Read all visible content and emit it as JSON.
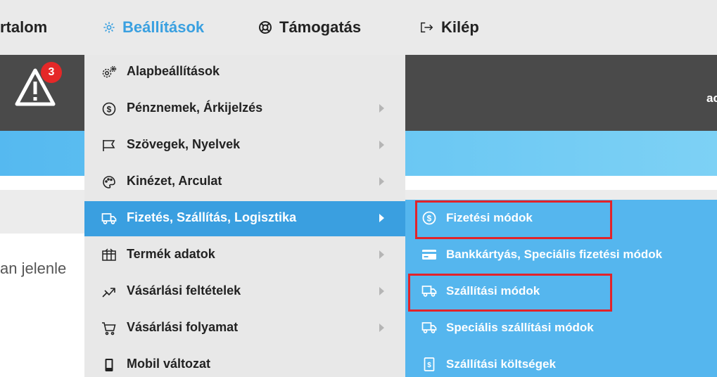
{
  "colors": {
    "accent": "#3aa0e0",
    "active_row": "#3a9fe0",
    "submenu_bg": "#55b6ee",
    "highlight": "#e2232a",
    "badge": "#e52828"
  },
  "topnav": {
    "items": [
      {
        "label": "rtalom",
        "icon": ""
      },
      {
        "label": "Beállítások",
        "icon": "gear-icon"
      },
      {
        "label": "Támogatás",
        "icon": "lifebuoy-icon"
      },
      {
        "label": "Kilép",
        "icon": "logout-icon"
      }
    ]
  },
  "background": {
    "alert_badge": "3",
    "header_right_text": "ac",
    "content_text": "an jelenle"
  },
  "menu": {
    "items": [
      {
        "label": "Alapbeállítások",
        "icon": "gears-icon",
        "has_submenu": false
      },
      {
        "label": "Pénznemek, Árkijelzés",
        "icon": "currency-icon",
        "has_submenu": true
      },
      {
        "label": "Szövegek, Nyelvek",
        "icon": "flag-icon",
        "has_submenu": true
      },
      {
        "label": "Kinézet, Arculat",
        "icon": "palette-icon",
        "has_submenu": true
      },
      {
        "label": "Fizetés, Szállítás, Logisztika",
        "icon": "truck-icon",
        "has_submenu": true,
        "active": true
      },
      {
        "label": "Termék adatok",
        "icon": "product-icon",
        "has_submenu": true
      },
      {
        "label": "Vásárlási feltételek",
        "icon": "handshake-icon",
        "has_submenu": true
      },
      {
        "label": "Vásárlási folyamat",
        "icon": "cart-icon",
        "has_submenu": true
      },
      {
        "label": "Mobil változat",
        "icon": "mobile-icon",
        "has_submenu": false
      }
    ]
  },
  "submenu": {
    "items": [
      {
        "label": "Fizetési módok",
        "icon": "currency-icon",
        "highlighted": true
      },
      {
        "label": "Bankkártyás, Speciális fizetési módok",
        "icon": "credit-card-icon",
        "highlighted": false
      },
      {
        "label": "Szállítási módok",
        "icon": "truck-icon",
        "highlighted": true
      },
      {
        "label": "Speciális szállítási módok",
        "icon": "truck-icon",
        "highlighted": false
      },
      {
        "label": "Szállítási költségek",
        "icon": "receipt-icon",
        "highlighted": false
      }
    ]
  }
}
